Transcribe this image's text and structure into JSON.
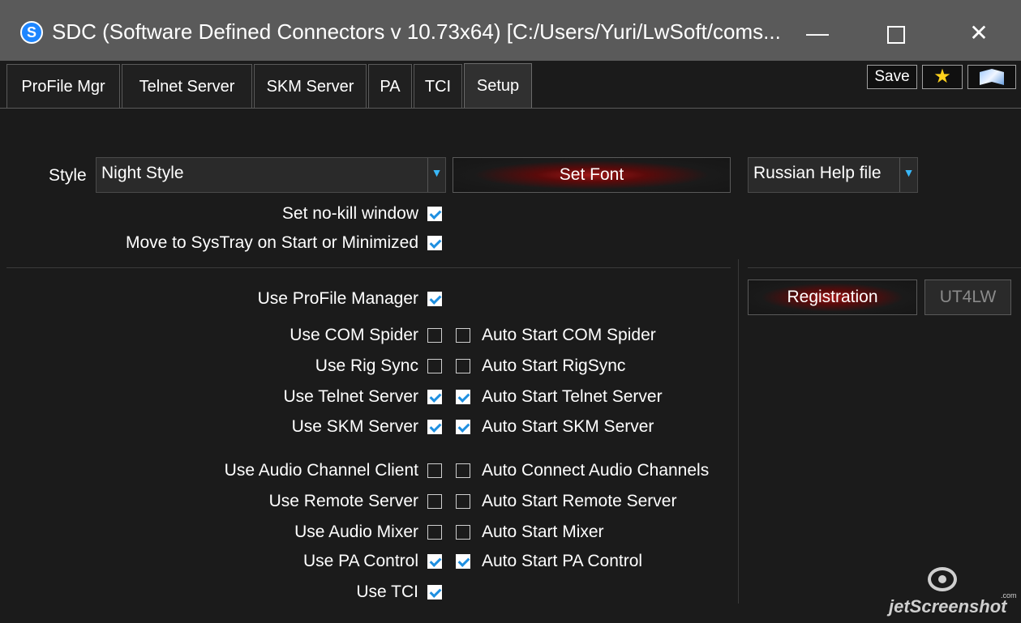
{
  "window": {
    "title": "SDC (Software Defined Connectors v 10.73x64) [C:/Users/Yuri/LwSoft/coms...",
    "icon_letter": "S",
    "minimize_glyph": "—",
    "close_glyph": "✕"
  },
  "tabs": [
    {
      "label": "ProFile Mgr"
    },
    {
      "label": "Telnet Server"
    },
    {
      "label": "SKM Server"
    },
    {
      "label": "PA"
    },
    {
      "label": "TCI"
    },
    {
      "label": "Setup",
      "active": true
    }
  ],
  "toolbar": {
    "save_label": "Save",
    "favorite_glyph": "★"
  },
  "setup": {
    "style_label": "Style",
    "style_value": "Night Style",
    "set_font_label": "Set Font",
    "help_file_value": "Russian Help file",
    "no_kill_label": "Set no-kill window",
    "no_kill_checked": true,
    "systray_label": "Move to SysTray on Start or Minimized",
    "systray_checked": true,
    "profile_manager_label": "Use ProFile Manager",
    "profile_manager_checked": true,
    "registration_label": "Registration",
    "callsign_value": "UT4LW",
    "options": [
      {
        "use_label": "Use COM Spider",
        "use_checked": false,
        "auto_label": "Auto Start COM Spider",
        "auto_checked": false
      },
      {
        "use_label": "Use Rig Sync",
        "use_checked": false,
        "auto_label": "Auto Start RigSync",
        "auto_checked": false
      },
      {
        "use_label": "Use Telnet Server",
        "use_checked": true,
        "auto_label": "Auto Start Telnet Server",
        "auto_checked": true
      },
      {
        "use_label": "Use SKM Server",
        "use_checked": true,
        "auto_label": "Auto Start SKM Server",
        "auto_checked": true
      },
      {
        "use_label": "Use Audio Channel Client",
        "use_checked": false,
        "auto_label": "Auto Connect Audio Channels",
        "auto_checked": false
      },
      {
        "use_label": "Use Remote Server",
        "use_checked": false,
        "auto_label": "Auto Start Remote Server",
        "auto_checked": false
      },
      {
        "use_label": "Use Audio Mixer",
        "use_checked": false,
        "auto_label": "Auto Start Mixer",
        "auto_checked": false
      },
      {
        "use_label": "Use PA Control",
        "use_checked": true,
        "auto_label": "Auto Start PA Control",
        "auto_checked": true
      }
    ],
    "tci_label": "Use TCI",
    "tci_checked": true
  },
  "watermark": {
    "text": "jetScreenshot",
    "suffix": ".com"
  },
  "colors": {
    "accent_check": "#1e8fe0",
    "combo_arrow": "#39b8f8",
    "button_glow": "#a01818"
  }
}
